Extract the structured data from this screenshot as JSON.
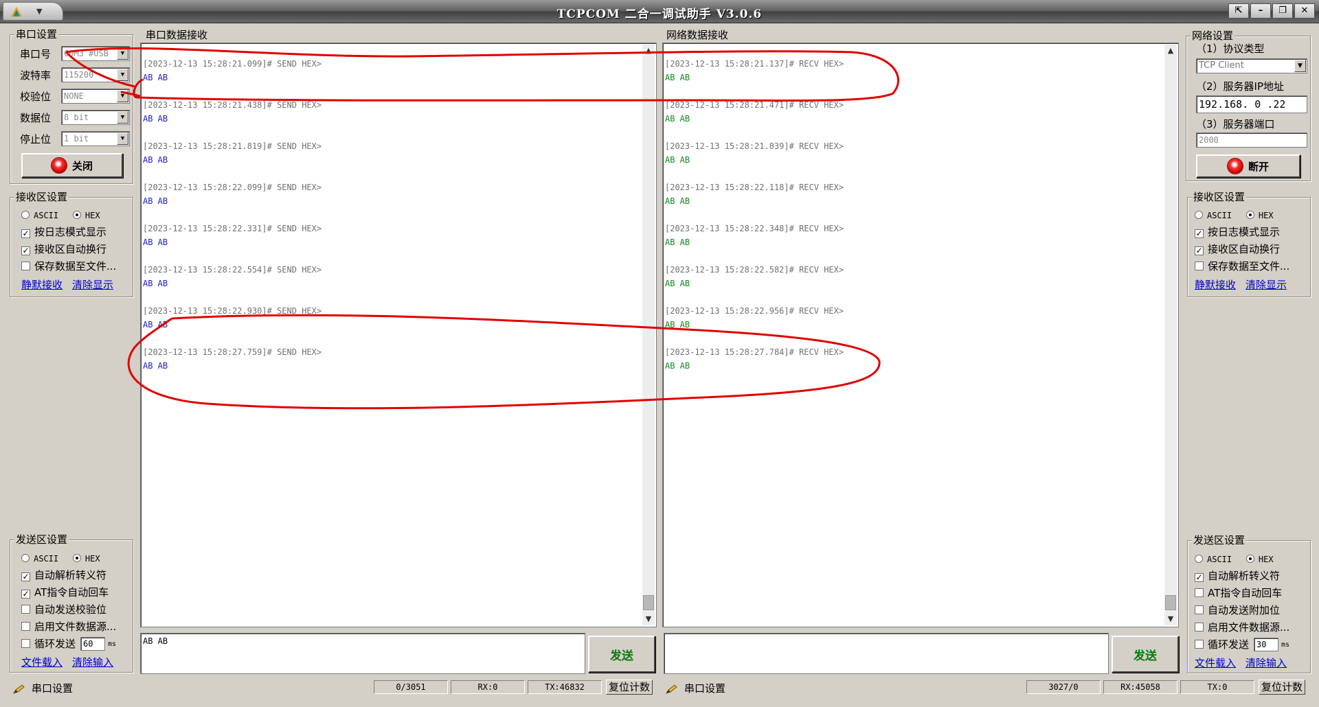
{
  "window": {
    "title": "TCPCOM  二合一调试助手    V3.0.6"
  },
  "serial_settings": {
    "title": "串口设置",
    "port_label": "串口号",
    "port_value": "COM3 #USB",
    "baud_label": "波特率",
    "baud_value": "115200",
    "parity_label": "校验位",
    "parity_value": "NONE",
    "databits_label": "数据位",
    "databits_value": "8 bit",
    "stopbits_label": "停止位",
    "stopbits_value": "1 bit",
    "close_button": "关闭"
  },
  "serial_recv_settings": {
    "title": "接收区设置",
    "ascii": "ASCII",
    "hex": "HEX",
    "log_mode": "按日志模式显示",
    "auto_wrap": "接收区自动换行",
    "save_file": "保存数据至文件...",
    "pause": "静默接收",
    "clear": "清除显示"
  },
  "serial_send_settings": {
    "title": "发送区设置",
    "ascii": "ASCII",
    "hex": "HEX",
    "escape": "自动解析转义符",
    "at_cr": "AT指令自动回车",
    "checksum": "自动发送校验位",
    "file_source": "启用文件数据源...",
    "loop": "循环发送",
    "loop_value": "60",
    "loop_unit": "ms",
    "load_file": "文件载入",
    "clear_input": "清除输入"
  },
  "serial_recv": {
    "title": "串口数据接收",
    "entries": [
      {
        "header": "[2023-12-13 15:28:21.099]# SEND HEX>",
        "data": "AB AB"
      },
      {
        "header": "[2023-12-13 15:28:21.438]# SEND HEX>",
        "data": "AB AB"
      },
      {
        "header": "[2023-12-13 15:28:21.819]# SEND HEX>",
        "data": "AB AB"
      },
      {
        "header": "[2023-12-13 15:28:22.099]# SEND HEX>",
        "data": "AB AB"
      },
      {
        "header": "[2023-12-13 15:28:22.331]# SEND HEX>",
        "data": "AB AB"
      },
      {
        "header": "[2023-12-13 15:28:22.554]# SEND HEX>",
        "data": "AB AB"
      },
      {
        "header": "[2023-12-13 15:28:22.930]# SEND HEX>",
        "data": "AB AB"
      },
      {
        "header": "[2023-12-13 15:28:27.759]# SEND HEX>",
        "data": "AB AB"
      }
    ]
  },
  "net_recv": {
    "title": "网络数据接收",
    "entries": [
      {
        "header": "[2023-12-13 15:28:21.137]# RECV HEX>",
        "data": "AB AB"
      },
      {
        "header": "[2023-12-13 15:28:21.471]# RECV HEX>",
        "data": "AB AB"
      },
      {
        "header": "[2023-12-13 15:28:21.839]# RECV HEX>",
        "data": "AB AB"
      },
      {
        "header": "[2023-12-13 15:28:22.118]# RECV HEX>",
        "data": "AB AB"
      },
      {
        "header": "[2023-12-13 15:28:22.348]# RECV HEX>",
        "data": "AB AB"
      },
      {
        "header": "[2023-12-13 15:28:22.582]# RECV HEX>",
        "data": "AB AB"
      },
      {
        "header": "[2023-12-13 15:28:22.956]# RECV HEX>",
        "data": "AB AB"
      },
      {
        "header": "[2023-12-13 15:28:27.784]# RECV HEX>",
        "data": "AB AB"
      }
    ]
  },
  "serial_send": {
    "value": "AB AB",
    "button": "发送"
  },
  "net_send": {
    "value": "",
    "button": "发送"
  },
  "net_settings": {
    "title": "网络设置",
    "proto_label": "（1）协议类型",
    "proto_value": "TCP Client",
    "ip_label": "（2）服务器IP地址",
    "ip_value": "192.168. 0 .22",
    "port_label": "（3）服务器端口",
    "port_value": "2000",
    "disconnect_button": "断开"
  },
  "net_recv_settings": {
    "title": "接收区设置",
    "ascii": "ASCII",
    "hex": "HEX",
    "log_mode": "按日志模式显示",
    "auto_wrap": "接收区自动换行",
    "save_file": "保存数据至文件...",
    "pause": "静默接收",
    "clear": "清除显示"
  },
  "net_send_settings": {
    "title": "发送区设置",
    "ascii": "ASCII",
    "hex": "HEX",
    "escape": "自动解析转义符",
    "at_cr": "AT指令自动回车",
    "checksum": "自动发送附加位",
    "file_source": "启用文件数据源...",
    "loop": "循环发送",
    "loop_value": "30",
    "loop_unit": "ms",
    "load_file": "文件载入",
    "clear_input": "清除输入"
  },
  "status_left": {
    "label": "串口设置",
    "count": "0/3051",
    "rx": "RX:0",
    "tx": "TX:46832",
    "reset": "复位计数"
  },
  "status_right": {
    "label": "串口设置",
    "count": "3027/0",
    "rx": "RX:45058",
    "tx": "TX:0",
    "reset": "复位计数"
  },
  "icons": {
    "led": "red-led-icon",
    "pen": "pencil-icon"
  },
  "colors": {
    "send_data": "#1c1cc8",
    "recv_data": "#0e8a1e",
    "annotation": "#e00000"
  }
}
